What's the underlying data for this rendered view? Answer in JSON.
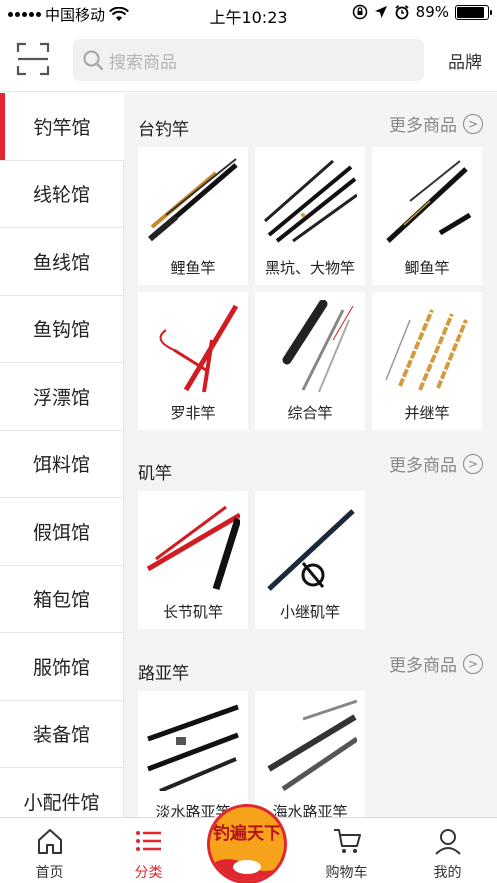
{
  "status_bar": {
    "carrier": "中国移动",
    "time": "上午10:23",
    "battery": "89%",
    "battery_level": 0.89
  },
  "header": {
    "search_placeholder": "搜索商品",
    "brand_label": "品牌"
  },
  "sidebar": {
    "items": [
      {
        "label": "钓竿馆",
        "active": true
      },
      {
        "label": "线轮馆"
      },
      {
        "label": "鱼线馆"
      },
      {
        "label": "鱼钩馆"
      },
      {
        "label": "浮漂馆"
      },
      {
        "label": "饵料馆"
      },
      {
        "label": "假饵馆"
      },
      {
        "label": "箱包馆"
      },
      {
        "label": "服饰馆"
      },
      {
        "label": "装备馆"
      },
      {
        "label": "小配件馆"
      }
    ]
  },
  "sections": [
    {
      "title": "台钓竿",
      "more": "更多商品",
      "products": [
        {
          "label": "鲤鱼竿"
        },
        {
          "label": "黑坑、大物竿"
        },
        {
          "label": "鲫鱼竿"
        },
        {
          "label": "罗非竿"
        },
        {
          "label": "综合竿"
        },
        {
          "label": "并继竿"
        }
      ]
    },
    {
      "title": "矶竿",
      "more": "更多商品",
      "products": [
        {
          "label": "长节矶竿"
        },
        {
          "label": "小继矶竿"
        }
      ]
    },
    {
      "title": "路亚竿",
      "more": "更多商品",
      "products": [
        {
          "label": "淡水路亚竿"
        },
        {
          "label": "海水路亚竿"
        }
      ]
    }
  ],
  "tabbar": {
    "tabs": [
      {
        "label": "首页",
        "icon": "home-icon"
      },
      {
        "label": "分类",
        "icon": "list-icon",
        "active": true
      },
      {
        "label": "购物车",
        "icon": "cart-icon"
      },
      {
        "label": "我的",
        "icon": "user-icon"
      }
    ],
    "center_logo_text": "钓遍天下"
  },
  "colors": {
    "accent": "#e0262f",
    "logo": "#f6a21b"
  }
}
